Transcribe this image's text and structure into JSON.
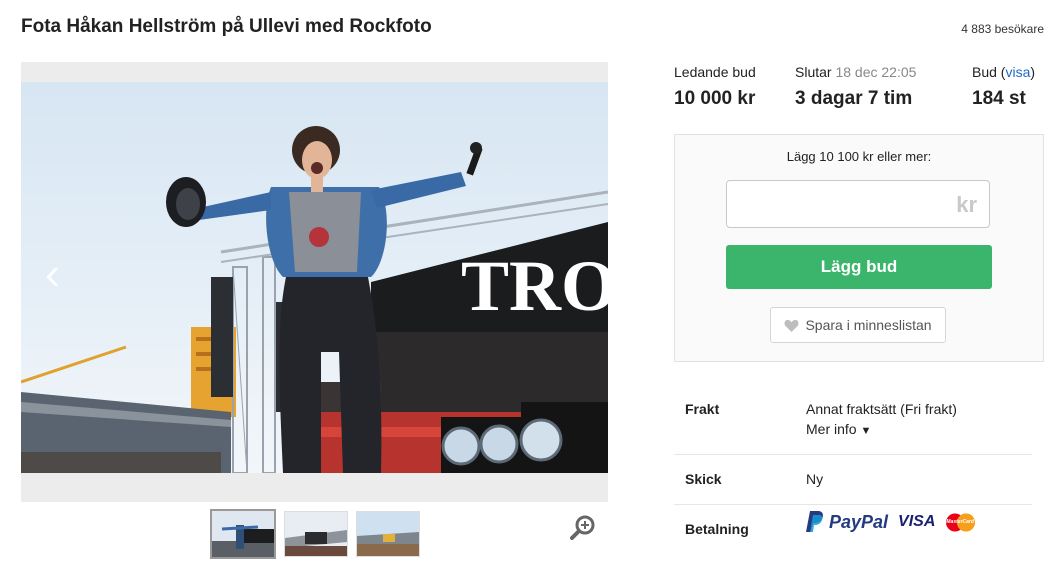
{
  "header": {
    "title": "Fota Håkan Hellström på Ullevi med Rockfoto",
    "visitors": "4 883 besökare"
  },
  "gallery": {
    "stage_banner_text": "TRO",
    "thumbnail_count": 3
  },
  "stats": {
    "leading_bid_label": "Ledande bud",
    "leading_bid_value": "10 000 kr",
    "ends_label": "Slutar",
    "ends_date": "18 dec 22:05",
    "ends_value": "3 dagar 7 tim",
    "bids_label": "Bud",
    "bids_link": "visa",
    "bids_value": "184 st"
  },
  "bid": {
    "min_text": "Lägg 10 100 kr eller mer:",
    "input_value": "",
    "currency": "kr",
    "button_label": "Lägg bud",
    "save_label": "Spara i minneslistan"
  },
  "details": {
    "shipping_label": "Frakt",
    "shipping_value": "Annat fraktsätt (Fri frakt)",
    "more_info": "Mer info",
    "condition_label": "Skick",
    "condition_value": "Ny",
    "payment_label": "Betalning",
    "paypal": "PayPal",
    "visa": "VISA",
    "mastercard": "MasterCard"
  },
  "colors": {
    "accent_green": "#3bb56b",
    "link_blue": "#1c6ac9",
    "paypal_dark": "#253b80",
    "paypal_light": "#179bd7",
    "visa_blue": "#1a1f71"
  }
}
